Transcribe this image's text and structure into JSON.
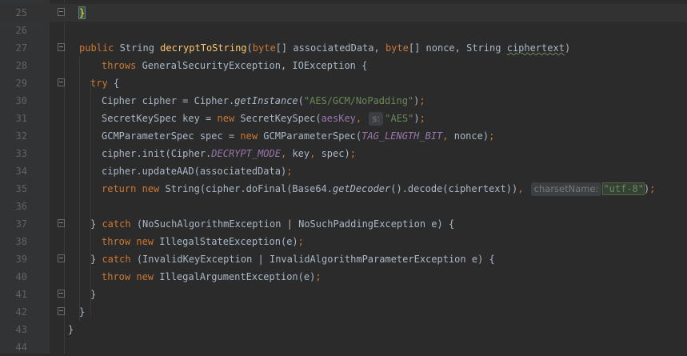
{
  "editor": {
    "lines": [
      {
        "num": "25",
        "t": [
          {
            "c": "brace-hl",
            "s": "}"
          }
        ]
      },
      {
        "num": "26",
        "t": []
      },
      {
        "num": "27",
        "t": [
          {
            "c": "kw",
            "s": "public "
          },
          {
            "c": "",
            "s": "String "
          },
          {
            "c": "fn",
            "s": "decryptToString"
          },
          {
            "c": "",
            "s": "("
          },
          {
            "c": "kw",
            "s": "byte"
          },
          {
            "c": "",
            "s": "[] associatedData, "
          },
          {
            "c": "kw",
            "s": "byte"
          },
          {
            "c": "",
            "s": "[] nonce, String "
          },
          {
            "c": "squig",
            "s": "ciphertext"
          },
          {
            "c": "",
            "s": ")"
          }
        ]
      },
      {
        "num": "28",
        "t": [
          {
            "c": "kw",
            "s": "throws "
          },
          {
            "c": "",
            "s": "GeneralSecurityException, IOException {"
          }
        ]
      },
      {
        "num": "29",
        "t": [
          {
            "c": "kw",
            "s": "try "
          },
          {
            "c": "",
            "s": "{"
          }
        ]
      },
      {
        "num": "30",
        "t": [
          {
            "c": "",
            "s": "Cipher cipher = Cipher."
          },
          {
            "c": "it",
            "s": "getInstance"
          },
          {
            "c": "",
            "s": "("
          },
          {
            "c": "st",
            "s": "\"AES/GCM/NoPadding\""
          },
          {
            "c": "",
            "s": ")"
          },
          {
            "c": "pu",
            "s": ";"
          }
        ]
      },
      {
        "num": "31",
        "t": [
          {
            "c": "",
            "s": "SecretKeySpec key = "
          },
          {
            "c": "kw",
            "s": "new "
          },
          {
            "c": "",
            "s": "SecretKeySpec("
          },
          {
            "c": "var",
            "s": "aesKey"
          },
          {
            "c": "pu",
            "s": ", "
          },
          {
            "c": "hint",
            "s": "s:"
          },
          {
            "c": "st",
            "s": "\"AES\""
          },
          {
            "c": "",
            "s": ")"
          },
          {
            "c": "pu",
            "s": ";"
          }
        ]
      },
      {
        "num": "32",
        "t": [
          {
            "c": "",
            "s": "GCMParameterSpec spec = "
          },
          {
            "c": "kw",
            "s": "new "
          },
          {
            "c": "",
            "s": "GCMParameterSpec("
          },
          {
            "c": "cst",
            "s": "TAG_LENGTH_BIT"
          },
          {
            "c": "pu",
            "s": ", "
          },
          {
            "c": "",
            "s": "nonce)"
          },
          {
            "c": "pu",
            "s": ";"
          }
        ]
      },
      {
        "num": "33",
        "t": [
          {
            "c": "",
            "s": "cipher.init(Cipher."
          },
          {
            "c": "cst",
            "s": "DECRYPT_MODE"
          },
          {
            "c": "pu",
            "s": ", "
          },
          {
            "c": "",
            "s": "key"
          },
          {
            "c": "pu",
            "s": ", "
          },
          {
            "c": "",
            "s": "spec)"
          },
          {
            "c": "pu",
            "s": ";"
          }
        ]
      },
      {
        "num": "34",
        "t": [
          {
            "c": "",
            "s": "cipher.updateAAD(associatedData)"
          },
          {
            "c": "pu",
            "s": ";"
          }
        ]
      },
      {
        "num": "35",
        "t": [
          {
            "c": "kw",
            "s": "return new "
          },
          {
            "c": "",
            "s": "String(cipher.doFinal(Base64."
          },
          {
            "c": "it",
            "s": "getDecoder"
          },
          {
            "c": "",
            "s": "().decode(ciphertext))"
          },
          {
            "c": "pu",
            "s": ", "
          },
          {
            "c": "hint",
            "s": "charsetName:"
          },
          {
            "c": "st hl",
            "s": "\"utf-8\""
          },
          {
            "c": "",
            "s": ")"
          },
          {
            "c": "pu",
            "s": ";"
          }
        ]
      },
      {
        "num": "36",
        "t": []
      },
      {
        "num": "37",
        "t": [
          {
            "c": "",
            "s": "} "
          },
          {
            "c": "kw",
            "s": "catch "
          },
          {
            "c": "",
            "s": "(NoSuchAlgorithmException | NoSuchPaddingException e) {"
          }
        ]
      },
      {
        "num": "38",
        "t": [
          {
            "c": "kw",
            "s": "throw new "
          },
          {
            "c": "",
            "s": "IllegalStateException(e)"
          },
          {
            "c": "pu",
            "s": ";"
          }
        ]
      },
      {
        "num": "39",
        "t": [
          {
            "c": "",
            "s": "} "
          },
          {
            "c": "kw",
            "s": "catch "
          },
          {
            "c": "",
            "s": "(InvalidKeyException | InvalidAlgorithmParameterException e) {"
          }
        ]
      },
      {
        "num": "40",
        "t": [
          {
            "c": "kw",
            "s": "throw new "
          },
          {
            "c": "",
            "s": "IllegalArgumentException(e)"
          },
          {
            "c": "pu",
            "s": ";"
          }
        ]
      },
      {
        "num": "41",
        "t": [
          {
            "c": "",
            "s": "}"
          }
        ]
      },
      {
        "num": "42",
        "t": [
          {
            "c": "",
            "s": "}"
          }
        ]
      },
      {
        "num": "43",
        "t": [
          {
            "c": "",
            "s": "}"
          }
        ]
      },
      {
        "num": "44",
        "t": []
      }
    ]
  },
  "colors": {
    "background": "#2b2b2b",
    "keyword": "#cc7832",
    "method": "#ffc66d",
    "string": "#6a8759",
    "field": "#9876aa",
    "text": "#a9b7c6"
  }
}
